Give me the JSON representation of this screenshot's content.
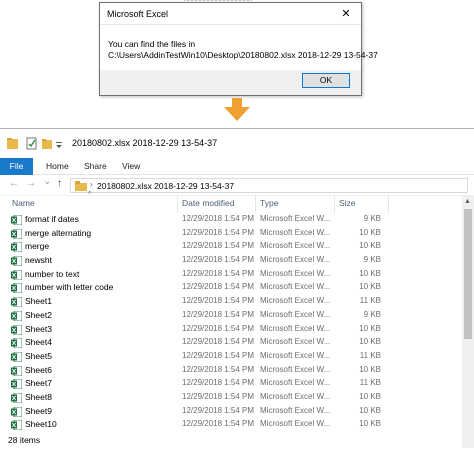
{
  "background_peek": "xxxxxxxxxxxxxxxxx",
  "dialog": {
    "title": "Microsoft Excel",
    "close_glyph": "✕",
    "message_line1": "You can find the files in",
    "message_line2": "C:\\Users\\AddinTestWin10\\Desktop\\20180802.xlsx 2018-12-29 13-54-37",
    "ok_label": "OK"
  },
  "arrow": {
    "color": "#f0a030",
    "icon": "down-arrow-icon"
  },
  "explorer": {
    "title": "20180802.xlsx 2018-12-29 13-54-37",
    "ribbon_tabs": [
      "File",
      "Home",
      "Share",
      "View"
    ],
    "nav": {
      "back": "←",
      "forward": "→",
      "recent": "⌄",
      "up": "↑"
    },
    "address_separator": "›",
    "address": "20180802.xlsx 2018-12-29 13-54-37",
    "columns": {
      "name": "Name",
      "date": "Date modified",
      "type": "Type",
      "size": "Size",
      "sort_glyph": "^"
    },
    "files": [
      {
        "name": "format if dates",
        "date": "12/29/2018 1:54 PM",
        "type": "Microsoft Excel W...",
        "size": "9 KB"
      },
      {
        "name": "merge  alternating",
        "date": "12/29/2018 1:54 PM",
        "type": "Microsoft Excel W...",
        "size": "10 KB"
      },
      {
        "name": "merge",
        "date": "12/29/2018 1:54 PM",
        "type": "Microsoft Excel W...",
        "size": "10 KB"
      },
      {
        "name": "newsht",
        "date": "12/29/2018 1:54 PM",
        "type": "Microsoft Excel W...",
        "size": "9 KB"
      },
      {
        "name": "number to text",
        "date": "12/29/2018 1:54 PM",
        "type": "Microsoft Excel W...",
        "size": "10 KB"
      },
      {
        "name": "number with letter code",
        "date": "12/29/2018 1:54 PM",
        "type": "Microsoft Excel W...",
        "size": "10 KB"
      },
      {
        "name": "Sheet1",
        "date": "12/29/2018 1:54 PM",
        "type": "Microsoft Excel W...",
        "size": "11 KB"
      },
      {
        "name": "Sheet2",
        "date": "12/29/2018 1:54 PM",
        "type": "Microsoft Excel W...",
        "size": "9 KB"
      },
      {
        "name": "Sheet3",
        "date": "12/29/2018 1:54 PM",
        "type": "Microsoft Excel W...",
        "size": "10 KB"
      },
      {
        "name": "Sheet4",
        "date": "12/29/2018 1:54 PM",
        "type": "Microsoft Excel W...",
        "size": "10 KB"
      },
      {
        "name": "Sheet5",
        "date": "12/29/2018 1:54 PM",
        "type": "Microsoft Excel W...",
        "size": "11 KB"
      },
      {
        "name": "Sheet6",
        "date": "12/29/2018 1:54 PM",
        "type": "Microsoft Excel W...",
        "size": "10 KB"
      },
      {
        "name": "Sheet7",
        "date": "12/29/2018 1:54 PM",
        "type": "Microsoft Excel W...",
        "size": "11 KB"
      },
      {
        "name": "Sheet8",
        "date": "12/29/2018 1:54 PM",
        "type": "Microsoft Excel W...",
        "size": "10 KB"
      },
      {
        "name": "Sheet9",
        "date": "12/29/2018 1:54 PM",
        "type": "Microsoft Excel W...",
        "size": "10 KB"
      },
      {
        "name": "Sheet10",
        "date": "12/29/2018 1:54 PM",
        "type": "Microsoft Excel W...",
        "size": "10 KB"
      }
    ],
    "status": "28 items",
    "colors": {
      "accent": "#1979ca",
      "excel_green": "#1e7145",
      "folder_yellow": "#e8b94a"
    }
  }
}
